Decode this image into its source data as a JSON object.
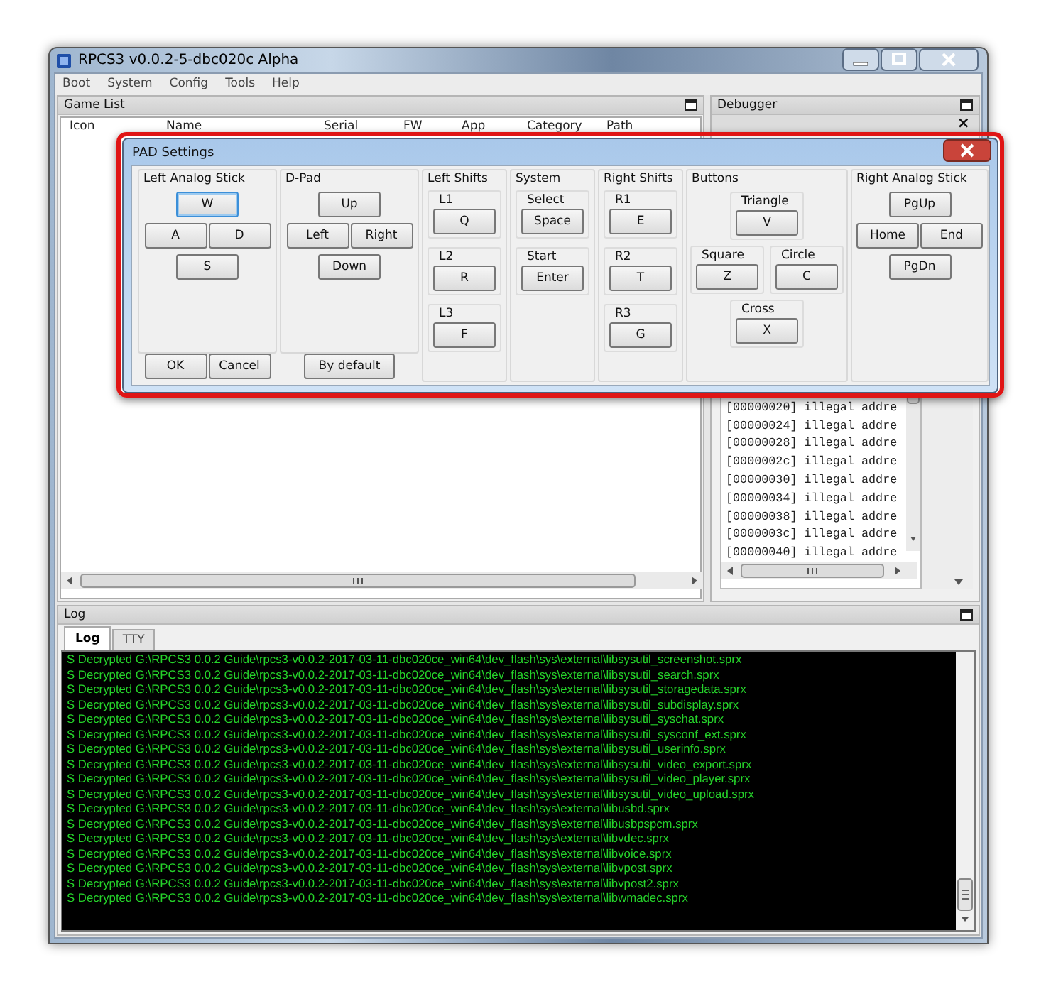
{
  "window": {
    "title": "RPCS3 v0.0.2-5-dbc020c Alpha"
  },
  "menu": [
    "Boot",
    "System",
    "Config",
    "Tools",
    "Help"
  ],
  "game_list": {
    "title": "Game List",
    "columns": [
      "Icon",
      "Name",
      "Serial",
      "FW",
      "App",
      "Category",
      "Path"
    ]
  },
  "debugger": {
    "title": "Debugger",
    "close_glyph": "×",
    "lines": [
      "[00000020] illegal addre",
      "[00000024] illegal addre",
      "[00000028] illegal addre",
      "[0000002c] illegal addre",
      "[00000030] illegal addre",
      "[00000034] illegal addre",
      "[00000038] illegal addre",
      "[0000003c] illegal addre",
      "[00000040] illegal addre"
    ]
  },
  "log": {
    "title": "Log",
    "tabs": [
      {
        "label": "Log",
        "selected": true
      },
      {
        "label": "TTY",
        "selected": false
      }
    ],
    "lines": [
      "S Decrypted G:\\RPCS3 0.0.2 Guide\\rpcs3-v0.0.2-2017-03-11-dbc020ce_win64\\dev_flash\\sys\\external\\libsysutil_screenshot.sprx",
      "S Decrypted G:\\RPCS3 0.0.2 Guide\\rpcs3-v0.0.2-2017-03-11-dbc020ce_win64\\dev_flash\\sys\\external\\libsysutil_search.sprx",
      "S Decrypted G:\\RPCS3 0.0.2 Guide\\rpcs3-v0.0.2-2017-03-11-dbc020ce_win64\\dev_flash\\sys\\external\\libsysutil_storagedata.sprx",
      "S Decrypted G:\\RPCS3 0.0.2 Guide\\rpcs3-v0.0.2-2017-03-11-dbc020ce_win64\\dev_flash\\sys\\external\\libsysutil_subdisplay.sprx",
      "S Decrypted G:\\RPCS3 0.0.2 Guide\\rpcs3-v0.0.2-2017-03-11-dbc020ce_win64\\dev_flash\\sys\\external\\libsysutil_syschat.sprx",
      "S Decrypted G:\\RPCS3 0.0.2 Guide\\rpcs3-v0.0.2-2017-03-11-dbc020ce_win64\\dev_flash\\sys\\external\\libsysutil_sysconf_ext.sprx",
      "S Decrypted G:\\RPCS3 0.0.2 Guide\\rpcs3-v0.0.2-2017-03-11-dbc020ce_win64\\dev_flash\\sys\\external\\libsysutil_userinfo.sprx",
      "S Decrypted G:\\RPCS3 0.0.2 Guide\\rpcs3-v0.0.2-2017-03-11-dbc020ce_win64\\dev_flash\\sys\\external\\libsysutil_video_export.sprx",
      "S Decrypted G:\\RPCS3 0.0.2 Guide\\rpcs3-v0.0.2-2017-03-11-dbc020ce_win64\\dev_flash\\sys\\external\\libsysutil_video_player.sprx",
      "S Decrypted G:\\RPCS3 0.0.2 Guide\\rpcs3-v0.0.2-2017-03-11-dbc020ce_win64\\dev_flash\\sys\\external\\libsysutil_video_upload.sprx",
      "S Decrypted G:\\RPCS3 0.0.2 Guide\\rpcs3-v0.0.2-2017-03-11-dbc020ce_win64\\dev_flash\\sys\\external\\libusbd.sprx",
      "S Decrypted G:\\RPCS3 0.0.2 Guide\\rpcs3-v0.0.2-2017-03-11-dbc020ce_win64\\dev_flash\\sys\\external\\libusbpspcm.sprx",
      "S Decrypted G:\\RPCS3 0.0.2 Guide\\rpcs3-v0.0.2-2017-03-11-dbc020ce_win64\\dev_flash\\sys\\external\\libvdec.sprx",
      "S Decrypted G:\\RPCS3 0.0.2 Guide\\rpcs3-v0.0.2-2017-03-11-dbc020ce_win64\\dev_flash\\sys\\external\\libvoice.sprx",
      "S Decrypted G:\\RPCS3 0.0.2 Guide\\rpcs3-v0.0.2-2017-03-11-dbc020ce_win64\\dev_flash\\sys\\external\\libvpost.sprx",
      "S Decrypted G:\\RPCS3 0.0.2 Guide\\rpcs3-v0.0.2-2017-03-11-dbc020ce_win64\\dev_flash\\sys\\external\\libvpost2.sprx",
      "S Decrypted G:\\RPCS3 0.0.2 Guide\\rpcs3-v0.0.2-2017-03-11-dbc020ce_win64\\dev_flash\\sys\\external\\libwmadec.sprx"
    ]
  },
  "dialog": {
    "title": "PAD Settings",
    "highlighted": true,
    "groups": [
      {
        "label": "Left Analog Stick",
        "kind": "cross",
        "keys": [
          {
            "key": "W",
            "focused": true
          },
          {
            "key": "A",
            "focused": false
          },
          {
            "key": "D",
            "focused": false
          },
          {
            "key": "S",
            "focused": false
          }
        ]
      },
      {
        "label": "D-Pad",
        "kind": "cross",
        "keys": [
          {
            "key": "Up",
            "focused": false
          },
          {
            "key": "Left",
            "focused": false
          },
          {
            "key": "Right",
            "focused": false
          },
          {
            "key": "Down",
            "focused": false
          }
        ]
      },
      {
        "label": "Left Shifts",
        "kind": "slots",
        "slots": [
          {
            "label": "L1",
            "key": "Q"
          },
          {
            "label": "L2",
            "key": "R"
          },
          {
            "label": "L3",
            "key": "F"
          }
        ]
      },
      {
        "label": "System",
        "kind": "slots",
        "slots": [
          {
            "label": "Select",
            "key": "Space"
          },
          {
            "label": "Start",
            "key": "Enter"
          }
        ]
      },
      {
        "label": "Right Shifts",
        "kind": "slots",
        "slots": [
          {
            "label": "R1",
            "key": "E"
          },
          {
            "label": "R2",
            "key": "T"
          },
          {
            "label": "R3",
            "key": "G"
          }
        ]
      },
      {
        "label": "Buttons",
        "kind": "face",
        "slots": [
          {
            "label": "Triangle",
            "key": "V"
          },
          {
            "label": "Square",
            "key": "Z"
          },
          {
            "label": "Circle",
            "key": "C"
          },
          {
            "label": "Cross",
            "key": "X"
          }
        ]
      },
      {
        "label": "Right Analog Stick",
        "kind": "cross",
        "keys": [
          {
            "key": "PgUp",
            "focused": false
          },
          {
            "key": "Home",
            "focused": false
          },
          {
            "key": "End",
            "focused": false
          },
          {
            "key": "PgDn",
            "focused": false
          }
        ]
      }
    ],
    "buttons": [
      "OK",
      "Cancel",
      "By default"
    ]
  }
}
